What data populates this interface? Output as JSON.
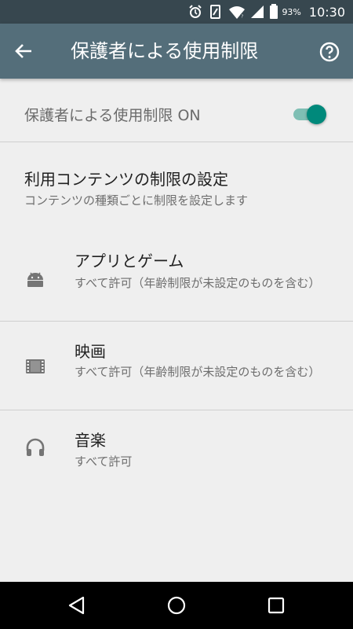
{
  "status_bar": {
    "battery_percent": "93%",
    "time": "10:30"
  },
  "toolbar": {
    "title": "保護者による使用制限",
    "back_icon": "arrow-back-icon",
    "help_icon": "help-circle-icon"
  },
  "master_switch": {
    "label": "保護者による使用制限 ON",
    "state": "on",
    "accent_color": "#00897b"
  },
  "section": {
    "title": "利用コンテンツの制限の設定",
    "subtitle": "コンテンツの種類ごとに制限を設定します"
  },
  "items": [
    {
      "title": "アプリとゲーム",
      "subtitle": "すべて許可（年齢制限が未設定のものを含む）",
      "icon": "android-icon"
    },
    {
      "title": "映画",
      "subtitle": "すべて許可（年齢制限が未設定のものを含む）",
      "icon": "movie-film-icon"
    },
    {
      "title": "音楽",
      "subtitle": "すべて許可",
      "icon": "headphones-icon"
    }
  ],
  "colors": {
    "status_bar": "#37474f",
    "toolbar": "#546e7a",
    "background": "#efefef"
  }
}
